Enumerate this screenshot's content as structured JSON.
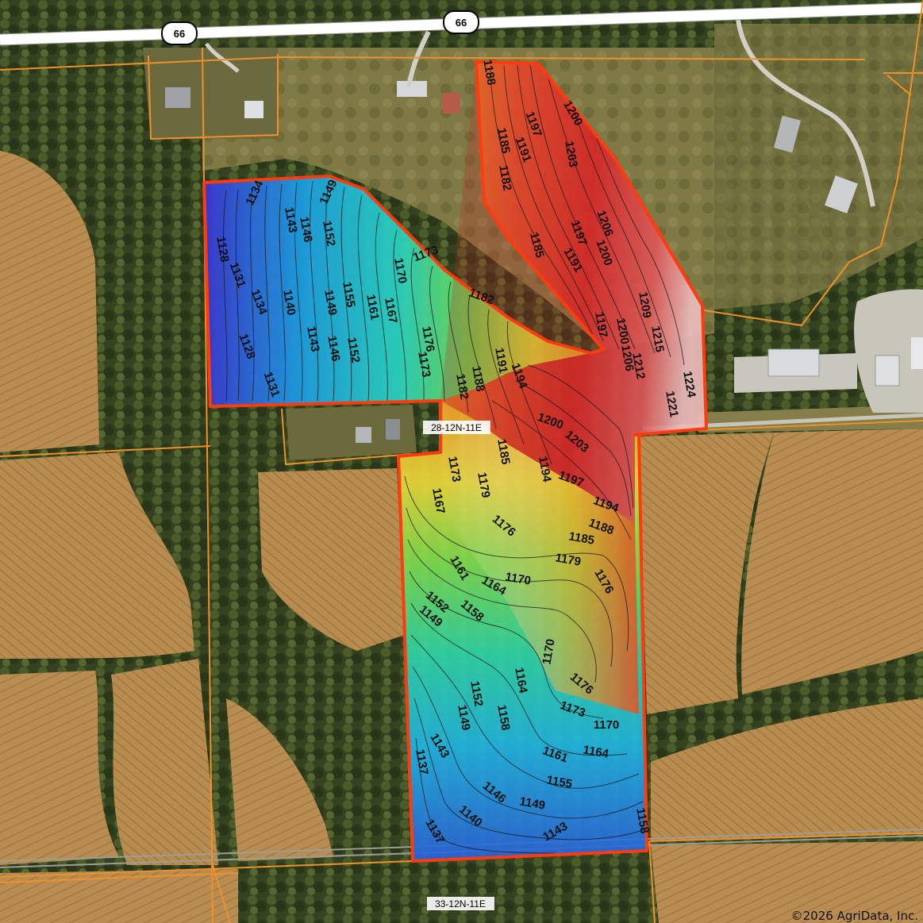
{
  "route_shields": [
    "66",
    "66"
  ],
  "section_labels": [
    "28-12N-11E",
    "33-12N-11E"
  ],
  "copyright": "©2026 AgriData, Inc.",
  "boundary_color": "#ff3b0f",
  "legend_colors": [
    "#3a3bd8",
    "#1fb5e0",
    "#35d27a",
    "#e8e83a",
    "#f08a2a",
    "#e23a2a",
    "#f2f0f0"
  ],
  "contour_labels": [
    "1188",
    "1200",
    "1197",
    "1185",
    "1191",
    "1203",
    "1182",
    "1206",
    "1197",
    "1185",
    "1200",
    "1191",
    "1209",
    "1197",
    "1134",
    "1149",
    "1143",
    "1146",
    "1152",
    "1128",
    "1131",
    "1173",
    "1170",
    "1182",
    "1134",
    "1140",
    "1149",
    "1155",
    "1161",
    "1167",
    "1176",
    "1143",
    "1146",
    "1152",
    "1128",
    "1131",
    "1173",
    "1182",
    "1188",
    "1191",
    "1194",
    "1200",
    "1206",
    "1215",
    "1212",
    "1224",
    "1221",
    "1200",
    "1203",
    "1185",
    "1197",
    "1194",
    "1173",
    "1179",
    "1194",
    "1167",
    "1188",
    "1176",
    "1185",
    "1161",
    "1164",
    "1170",
    "1179",
    "1176",
    "1152",
    "1158",
    "1149",
    "1170",
    "1164",
    "1176",
    "1152",
    "1173",
    "1149",
    "1158",
    "1143",
    "1170",
    "1161",
    "1164",
    "1137",
    "1146",
    "1155",
    "1149",
    "1140",
    "1137",
    "1143",
    "1158"
  ]
}
